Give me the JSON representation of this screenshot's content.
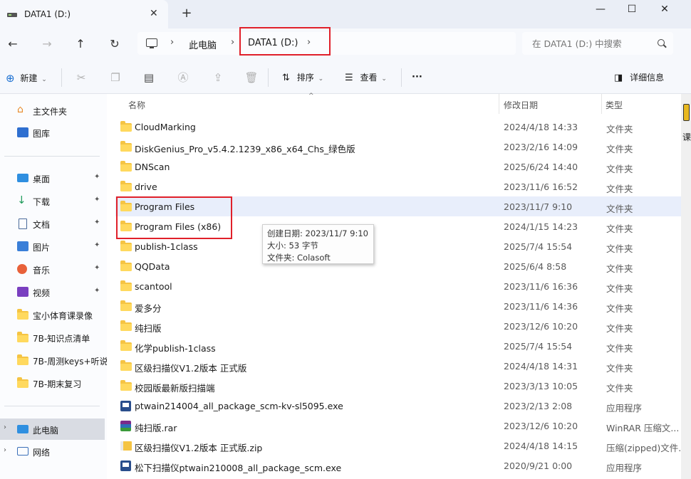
{
  "window": {
    "tab_title": "DATA1 (D:)",
    "tab_close": "✕",
    "new_tab": "+",
    "minimize": "—",
    "maximize": "☐",
    "close": "✕"
  },
  "nav": {
    "back": "←",
    "forward": "→",
    "up": "↑",
    "refresh": "↻"
  },
  "address": {
    "crumbs": [
      "此电脑",
      "DATA1 (D:)"
    ],
    "separator": "›",
    "search_placeholder": "在 DATA1 (D:) 中搜索"
  },
  "toolbar": {
    "new_label": "新建",
    "sort_label": "排序",
    "view_label": "查看",
    "more_label": "···",
    "details_label": "详细信息",
    "dropdown": "⌄",
    "icons": [
      "cut-icon",
      "copy-icon",
      "paste-icon",
      "rename-icon",
      "share-icon",
      "delete-icon"
    ]
  },
  "sidebar": {
    "top": [
      {
        "label": "主文件夹",
        "icon": "home-icon"
      },
      {
        "label": "图库",
        "icon": "gallery-icon"
      }
    ],
    "pinned": [
      {
        "label": "桌面",
        "icon": "desktop-icon"
      },
      {
        "label": "下载",
        "icon": "download-icon"
      },
      {
        "label": "文档",
        "icon": "documents-icon"
      },
      {
        "label": "图片",
        "icon": "pictures-icon"
      },
      {
        "label": "音乐",
        "icon": "music-icon"
      },
      {
        "label": "视频",
        "icon": "videos-icon"
      }
    ],
    "folders": [
      "宝小体育课录像",
      "7B-知识点清单",
      "7B-周测keys+听说",
      "7B-期末复习"
    ],
    "bottom": [
      {
        "label": "此电脑",
        "icon": "this-pc-icon",
        "selected": true
      },
      {
        "label": "网络",
        "icon": "network-icon",
        "selected": false
      }
    ],
    "pin_glyph": "📌",
    "expander_glyph": "›"
  },
  "columns": {
    "name": "名称",
    "date": "修改日期",
    "type": "类型",
    "sort_arrow": "^"
  },
  "files": [
    {
      "name": "CloudMarking",
      "date": "2024/4/18 14:33",
      "type": "文件夹",
      "kind": "folder"
    },
    {
      "name": "DiskGenius_Pro_v5.4.2.1239_x86_x64_Chs_绿色版",
      "date": "2023/2/16 14:09",
      "type": "文件夹",
      "kind": "folder"
    },
    {
      "name": "DNScan",
      "date": "2025/6/24 14:40",
      "type": "文件夹",
      "kind": "folder"
    },
    {
      "name": "drive",
      "date": "2023/11/6 16:52",
      "type": "文件夹",
      "kind": "folder"
    },
    {
      "name": "Program Files",
      "date": "2023/11/7 9:10",
      "type": "文件夹",
      "kind": "folder"
    },
    {
      "name": "Program Files (x86)",
      "date": "2024/1/15 14:23",
      "type": "文件夹",
      "kind": "folder"
    },
    {
      "name": "publish-1class",
      "date": "2025/7/4 15:54",
      "type": "文件夹",
      "kind": "folder"
    },
    {
      "name": "QQData",
      "date": "2025/6/4 8:58",
      "type": "文件夹",
      "kind": "folder"
    },
    {
      "name": "scantool",
      "date": "2023/11/6 16:36",
      "type": "文件夹",
      "kind": "folder"
    },
    {
      "name": "爱多分",
      "date": "2023/11/6 14:36",
      "type": "文件夹",
      "kind": "folder"
    },
    {
      "name": "纯扫版",
      "date": "2023/12/6 10:20",
      "type": "文件夹",
      "kind": "folder"
    },
    {
      "name": "化学publish-1class",
      "date": "2025/7/4 15:54",
      "type": "文件夹",
      "kind": "folder"
    },
    {
      "name": "区级扫描仪V1.2版本 正式版",
      "date": "2024/4/18 14:31",
      "type": "文件夹",
      "kind": "folder"
    },
    {
      "name": "校园版最新版扫描端",
      "date": "2023/3/13 10:05",
      "type": "文件夹",
      "kind": "folder"
    },
    {
      "name": "ptwain214004_all_package_scm-kv-sl5095.exe",
      "date": "2023/2/13 2:08",
      "type": "应用程序",
      "kind": "exe"
    },
    {
      "name": "纯扫版.rar",
      "date": "2023/12/6 10:20",
      "type": "WinRAR 压缩文...",
      "kind": "rar"
    },
    {
      "name": "区级扫描仪V1.2版本 正式版.zip",
      "date": "2024/4/18 14:15",
      "type": "压缩(zipped)文件...",
      "kind": "zip"
    },
    {
      "name": "松下扫描仪ptwain210008_all_package_scm.exe",
      "date": "2020/9/21 0:00",
      "type": "应用程序",
      "kind": "exe"
    }
  ],
  "tooltip": {
    "created": "创建日期: 2023/11/7 9:10",
    "size": "大小: 53 字节",
    "folders": "文件夹: Colasoft"
  },
  "peek_text": "课"
}
